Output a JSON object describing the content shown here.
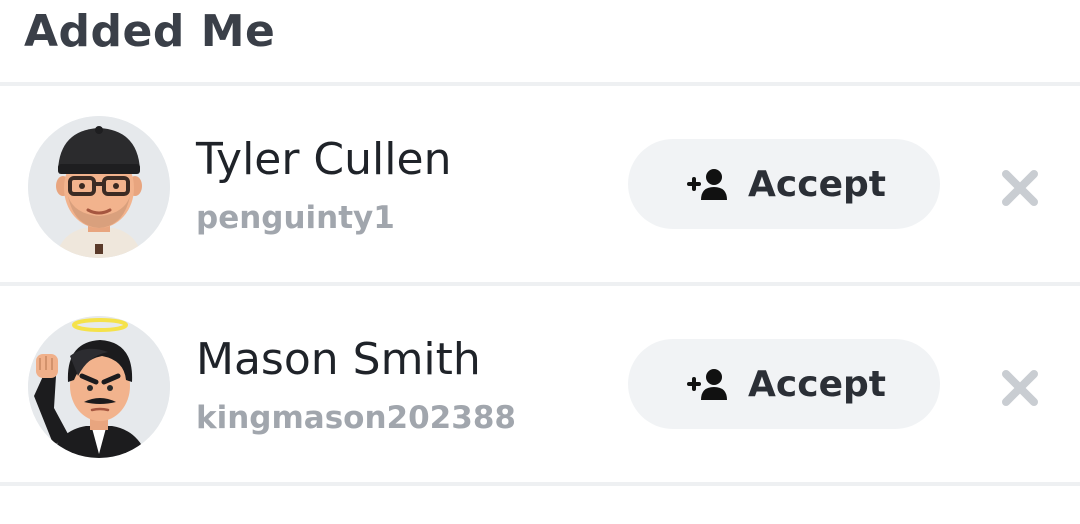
{
  "header": {
    "title": "Added Me"
  },
  "requests": [
    {
      "display_name": "Tyler Cullen",
      "username": "penguinty1",
      "accept_label": "Accept",
      "avatar_icon": "bitmoji-avatar-cap-glasses-icon",
      "dismiss_icon": "close-icon"
    },
    {
      "display_name": "Mason Smith",
      "username": "kingmason202388",
      "accept_label": "Accept",
      "avatar_icon": "bitmoji-avatar-halo-fist-icon",
      "dismiss_icon": "close-icon"
    }
  ],
  "colors": {
    "title": "#3a3f48",
    "name": "#1f2329",
    "username": "#a1a6ad",
    "button_bg": "#f1f3f5",
    "dismiss": "#c9cdd2",
    "separator": "#eef0f2"
  }
}
